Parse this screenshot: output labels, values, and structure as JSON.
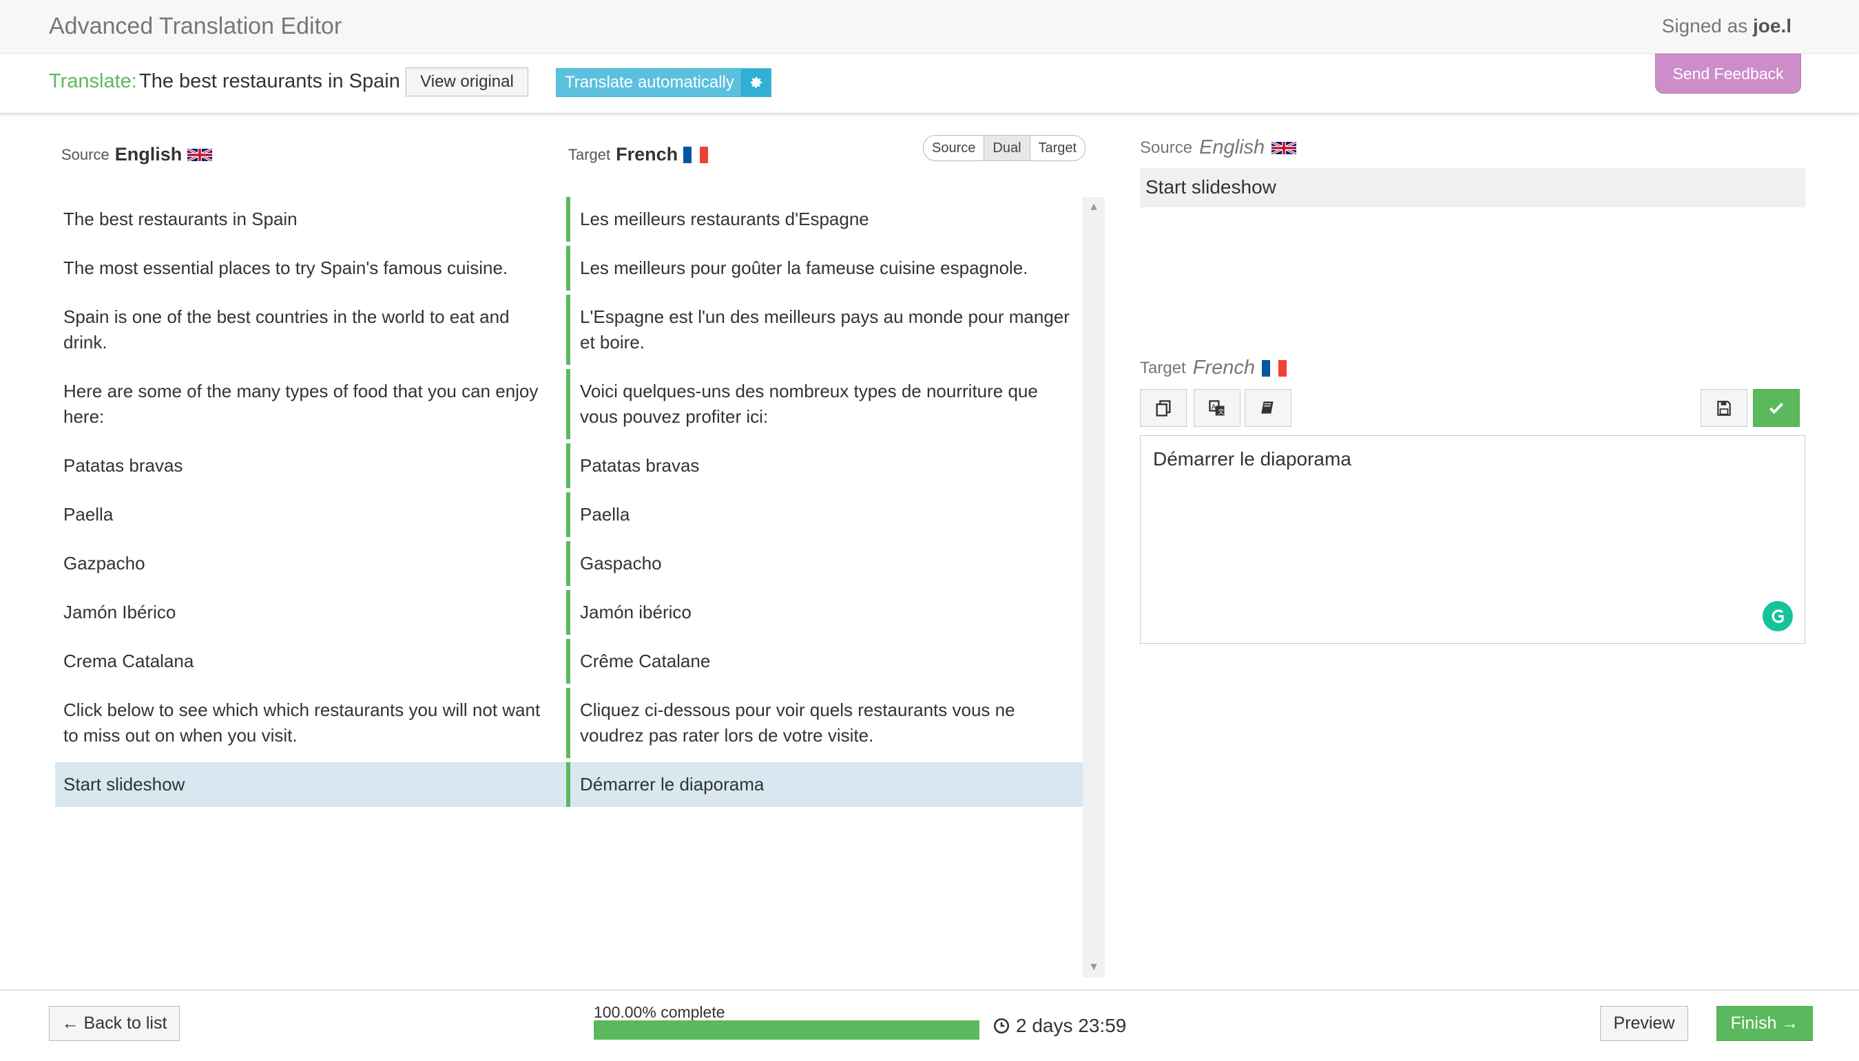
{
  "app": {
    "title": "Advanced Translation Editor",
    "signed_prefix": "Signed as",
    "user": "joe.l"
  },
  "header": {
    "translate_label": "Translate:",
    "document_title": "The best restaurants in Spain",
    "view_original": "View original",
    "translate_automatically": "Translate automatically",
    "send_feedback": "Send Feedback"
  },
  "columns": {
    "source_label": "Source",
    "source_lang": "English",
    "target_label": "Target",
    "target_lang": "French",
    "view_modes": [
      "Source",
      "Dual",
      "Target"
    ],
    "active_view_mode": "Dual"
  },
  "segments": [
    {
      "source": "The best restaurants in Spain",
      "target": "Les meilleurs restaurants d'Espagne"
    },
    {
      "source": "The most essential places to try Spain's famous cuisine.",
      "target": "Les meilleurs pour goûter la fameuse cuisine espagnole."
    },
    {
      "source": "Spain is one of the best countries in the world to eat and drink.",
      "target": "L'Espagne est l'un des meilleurs pays au monde pour manger et boire."
    },
    {
      "source": "Here are some of the many types of food that you can enjoy here:",
      "target": "Voici quelques-uns des nombreux types de nourriture que vous pouvez profiter ici:"
    },
    {
      "source": "Patatas bravas",
      "target": "Patatas bravas"
    },
    {
      "source": "Paella",
      "target": "Paella"
    },
    {
      "source": "Gazpacho",
      "target": "Gaspacho"
    },
    {
      "source": "Jamón Ibérico",
      "target": "Jamón ibérico"
    },
    {
      "source": "Crema Catalana",
      "target": "Crême Catalane"
    },
    {
      "source": "Click below to see which which restaurants you will not want to miss out on when you visit.",
      "target": "Cliquez ci-dessous pour voir quels restaurants vous ne voudrez pas rater lors de votre visite."
    },
    {
      "source": "Start slideshow",
      "target": "Démarrer le diaporama"
    }
  ],
  "active_segment_index": 10,
  "editor": {
    "source_label": "Source",
    "source_lang": "English",
    "source_text": "Start slideshow",
    "target_label": "Target",
    "target_lang": "French",
    "target_text": "Démarrer le diaporama"
  },
  "footer": {
    "back": "← Back to list",
    "progress_text": "100.00% complete",
    "progress_fraction": 1.0,
    "timer": "2 days 23:59",
    "preview": "Preview",
    "finish": "Finish →"
  },
  "colors": {
    "success": "#5cb85c",
    "info": "#5bc0de",
    "feedback": "#cc8dc9",
    "active_row": "#d9e7f0"
  }
}
